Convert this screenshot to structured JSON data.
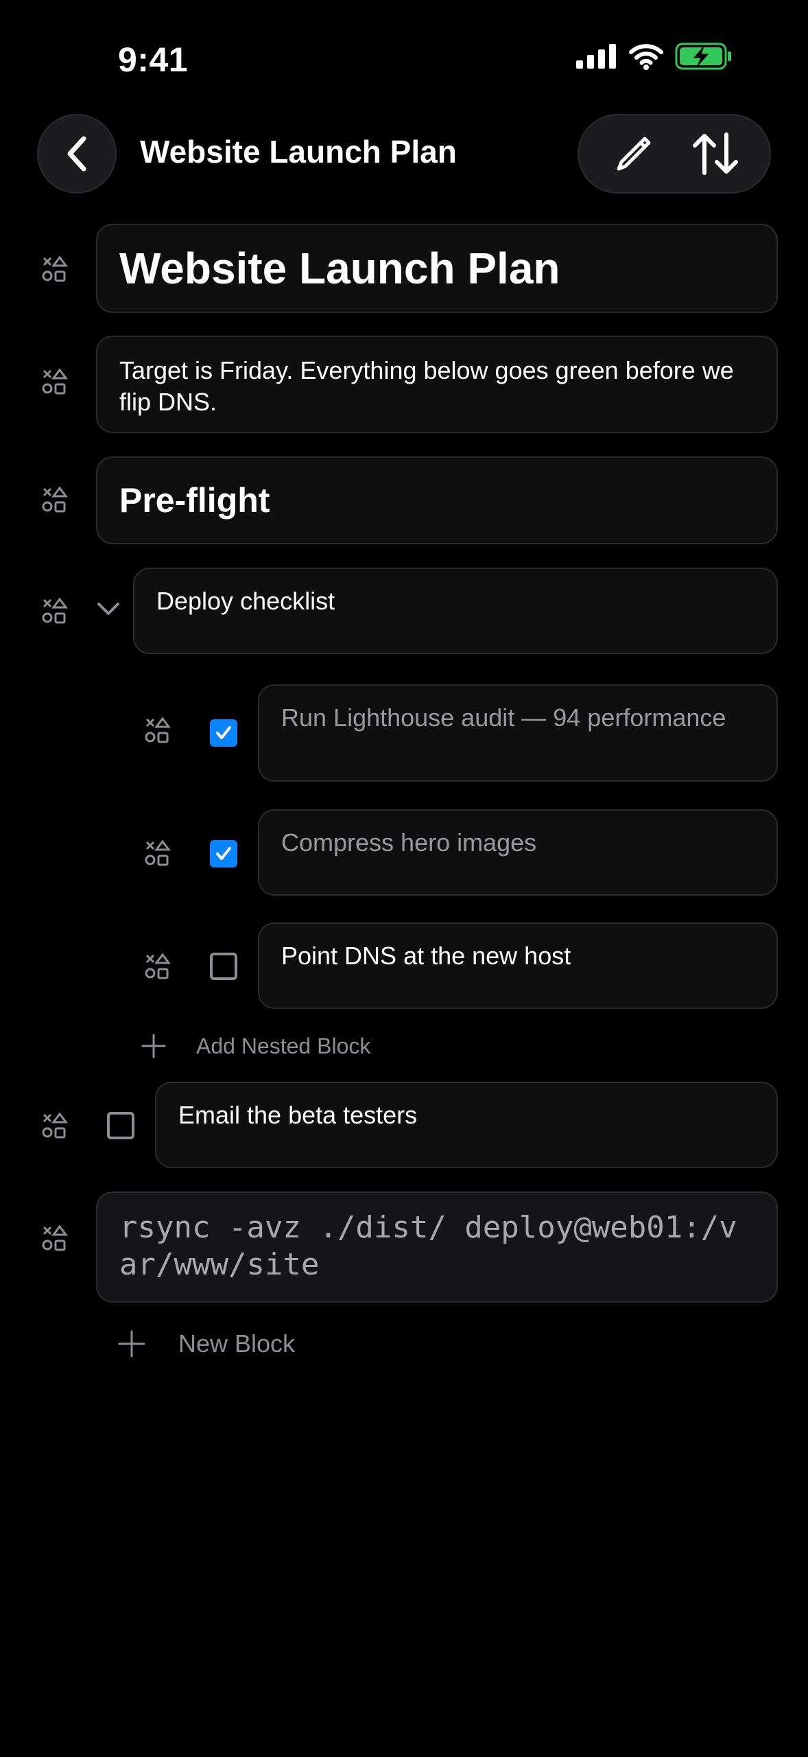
{
  "status_bar": {
    "time": "9:41"
  },
  "nav": {
    "title": "Website Launch Plan"
  },
  "blocks": {
    "title": "Website Launch Plan",
    "paragraph": "Target is Friday. Everything below goes green before we flip DNS.",
    "heading": "Pre-flight",
    "toggle": "Deploy checklist",
    "nested": [
      {
        "label": "Run Lighthouse audit — 94 performance",
        "checked": true
      },
      {
        "label": "Compress hero images",
        "checked": true
      },
      {
        "label": "Point DNS at the new host",
        "checked": false
      }
    ],
    "add_nested": "Add Nested Block",
    "todo": {
      "label": "Email the beta testers",
      "checked": false
    },
    "code": "rsync -avz ./dist/ deploy@web01:/var/www/site",
    "new_block": "New Block"
  },
  "colors": {
    "accent": "#0a84ff",
    "battery": "#34c759",
    "background": "#000000"
  }
}
